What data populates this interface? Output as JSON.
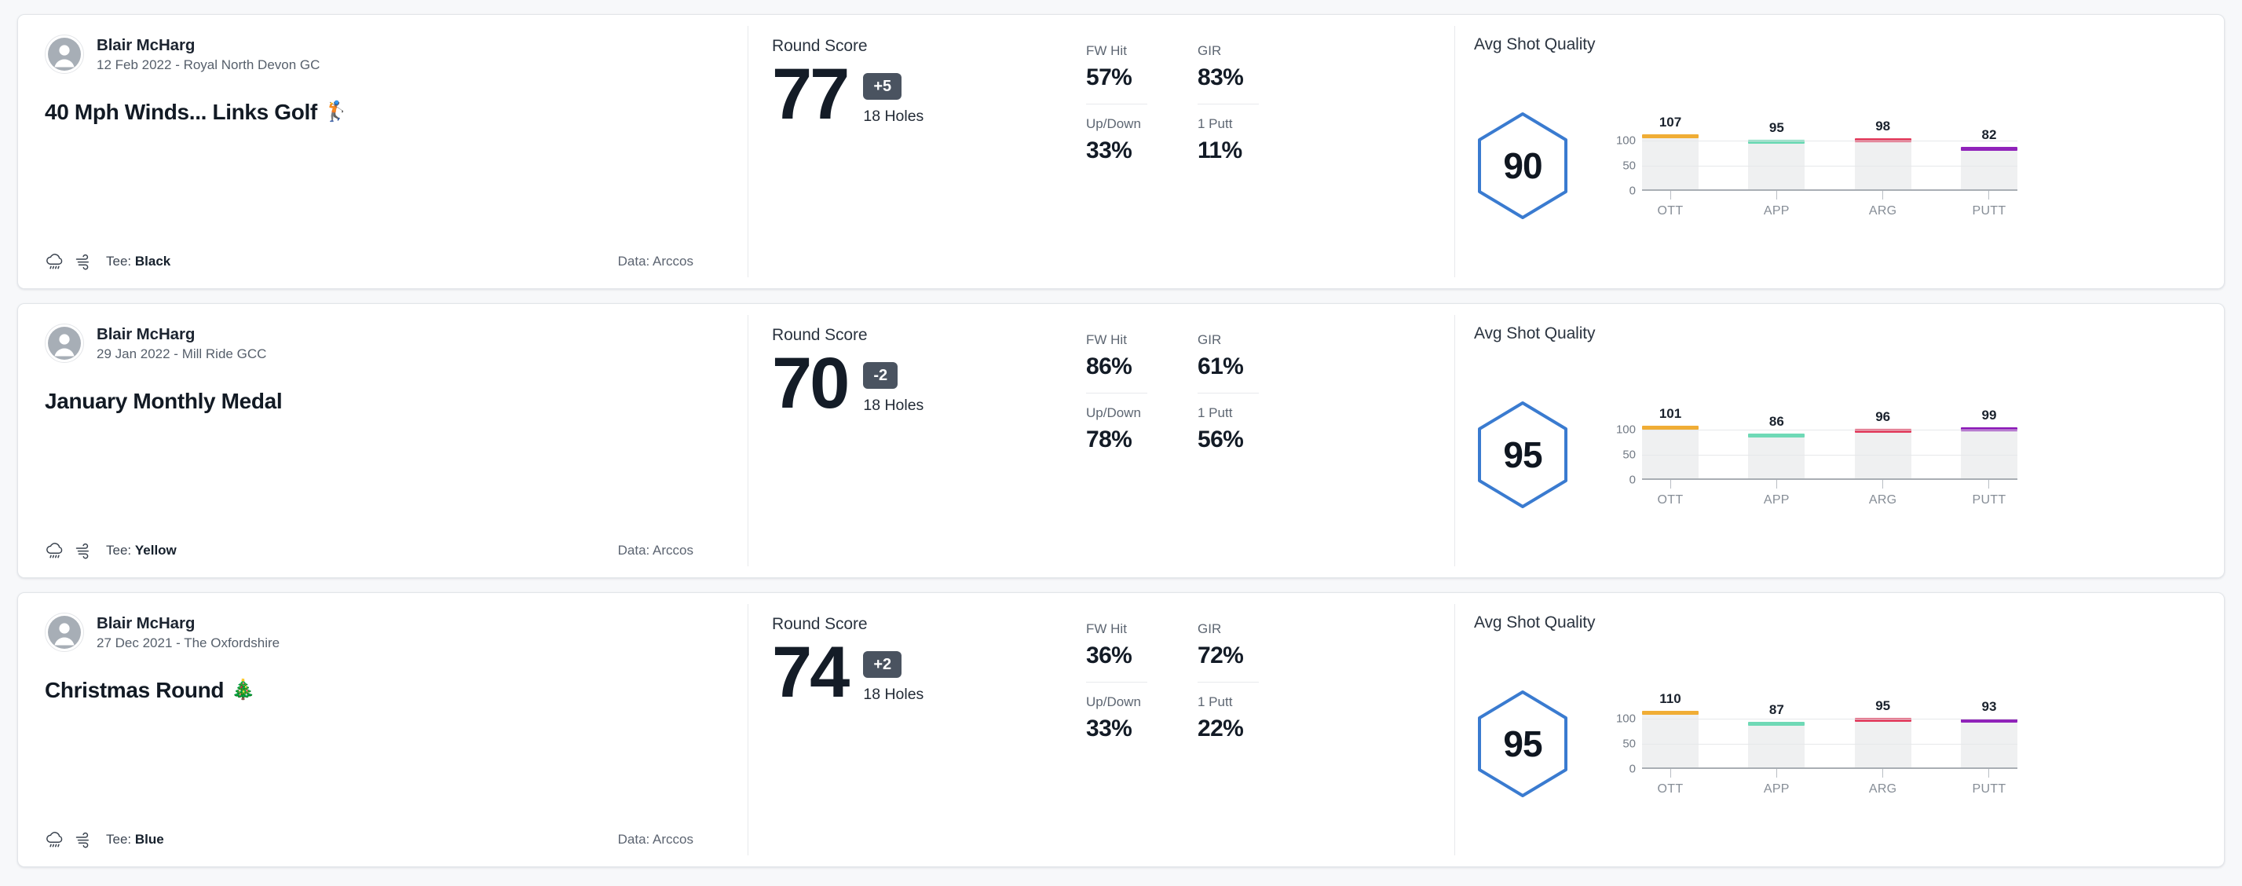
{
  "theme": {
    "card_bg": "#ffffff",
    "page_bg": "#f7f8fa",
    "hex_stroke": "#3a7bd0",
    "badge_bg": "#4a5360",
    "bar_track": "#eff0f1",
    "series_colors": {
      "OTT": "#f0ad35",
      "APP": "#6fd9b6",
      "ARG": "#e24464",
      "PUTT": "#9023ba"
    }
  },
  "labels": {
    "round_score": "Round Score",
    "holes": "18 Holes",
    "avg_shot_quality": "Avg Shot Quality",
    "tee_prefix": "Tee: ",
    "data_prefix": "Data: ",
    "stat_fw": "FW Hit",
    "stat_gir": "GIR",
    "stat_updown": "Up/Down",
    "stat_1putt": "1 Putt",
    "y_ticks": [
      "100",
      "50",
      "0"
    ]
  },
  "cards": [
    {
      "user": "Blair McHarg",
      "subtitle": "12 Feb 2022 - Royal North Devon GC",
      "title": "40 Mph Winds... Links Golf",
      "title_emoji": "🏌️",
      "weather_icons": [
        "rain-cloud-icon",
        "wind-icon"
      ],
      "tee": "Black",
      "data_source": "Arccos",
      "score": "77",
      "diff": "+5",
      "holes": "18 Holes",
      "stats": {
        "fw_hit": "57%",
        "gir": "83%",
        "up_down": "33%",
        "one_putt": "11%"
      },
      "shot_quality": "90",
      "chart_data": {
        "type": "bar",
        "title": "Avg Shot Quality",
        "categories": [
          "OTT",
          "APP",
          "ARG",
          "PUTT"
        ],
        "values": [
          107,
          95,
          98,
          82
        ],
        "colors": [
          "#f0ad35",
          "#6fd9b6",
          "#e24464",
          "#9023ba"
        ],
        "ylim": [
          0,
          125
        ],
        "yticks": [
          0,
          50,
          100
        ],
        "ylabel": "",
        "xlabel": "",
        "grid": true,
        "legend": "none"
      }
    },
    {
      "user": "Blair McHarg",
      "subtitle": "29 Jan 2022 - Mill Ride GCC",
      "title": "January Monthly Medal",
      "title_emoji": "",
      "weather_icons": [
        "rain-cloud-icon",
        "wind-icon"
      ],
      "tee": "Yellow",
      "data_source": "Arccos",
      "score": "70",
      "diff": "-2",
      "holes": "18 Holes",
      "stats": {
        "fw_hit": "86%",
        "gir": "61%",
        "up_down": "78%",
        "one_putt": "56%"
      },
      "shot_quality": "95",
      "chart_data": {
        "type": "bar",
        "title": "Avg Shot Quality",
        "categories": [
          "OTT",
          "APP",
          "ARG",
          "PUTT"
        ],
        "values": [
          101,
          86,
          96,
          99
        ],
        "colors": [
          "#f0ad35",
          "#6fd9b6",
          "#e24464",
          "#9023ba"
        ],
        "ylim": [
          0,
          125
        ],
        "yticks": [
          0,
          50,
          100
        ],
        "ylabel": "",
        "xlabel": "",
        "grid": true,
        "legend": "none"
      }
    },
    {
      "user": "Blair McHarg",
      "subtitle": "27 Dec 2021 - The Oxfordshire",
      "title": "Christmas Round",
      "title_emoji": "🎄",
      "weather_icons": [
        "rain-cloud-icon",
        "wind-icon"
      ],
      "tee": "Blue",
      "data_source": "Arccos",
      "score": "74",
      "diff": "+2",
      "holes": "18 Holes",
      "stats": {
        "fw_hit": "36%",
        "gir": "72%",
        "up_down": "33%",
        "one_putt": "22%"
      },
      "shot_quality": "95",
      "chart_data": {
        "type": "bar",
        "title": "Avg Shot Quality",
        "categories": [
          "OTT",
          "APP",
          "ARG",
          "PUTT"
        ],
        "values": [
          110,
          87,
          95,
          93
        ],
        "colors": [
          "#f0ad35",
          "#6fd9b6",
          "#e24464",
          "#9023ba"
        ],
        "ylim": [
          0,
          125
        ],
        "yticks": [
          0,
          50,
          100
        ],
        "ylabel": "",
        "xlabel": "",
        "grid": true,
        "legend": "none"
      }
    }
  ]
}
